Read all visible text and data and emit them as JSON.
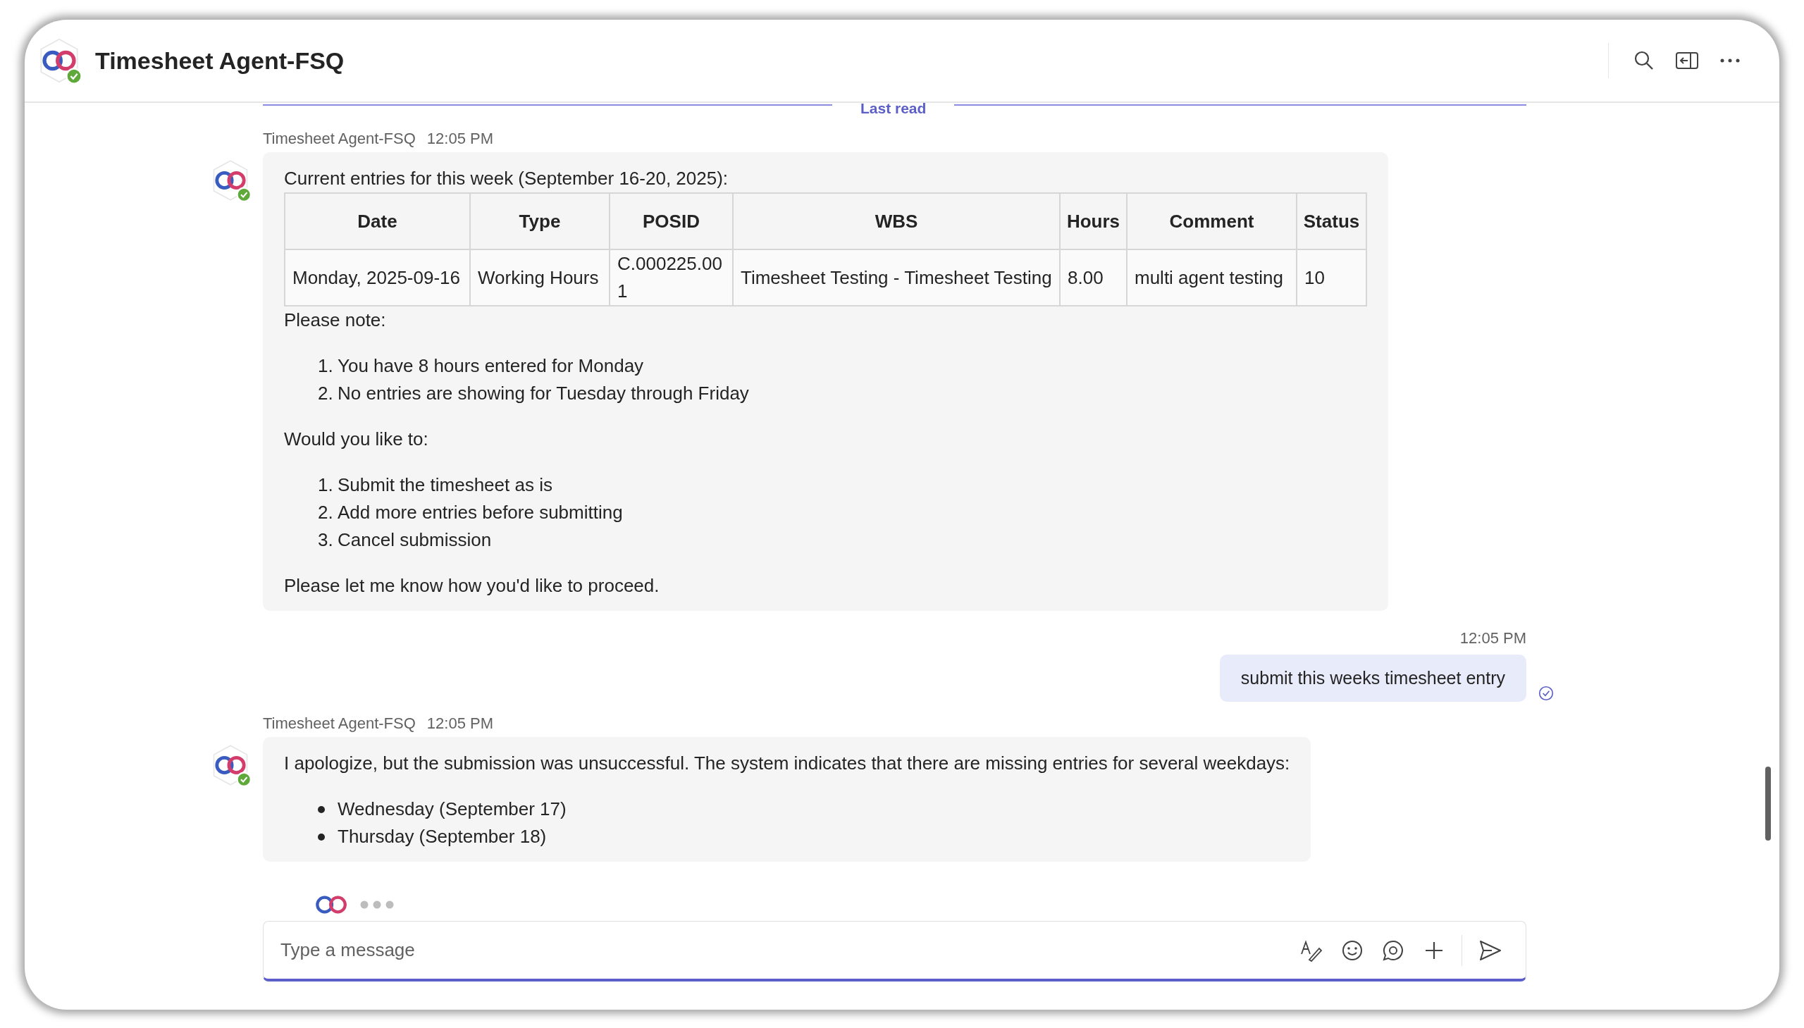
{
  "header": {
    "title": "Timesheet Agent-FSQ",
    "online": true
  },
  "last_read": "Last read",
  "messages": [
    {
      "kind": "bot",
      "sender": "Timesheet Agent-FSQ",
      "time": "12:05 PM",
      "online": true,
      "blocks": [
        {
          "kind": "paragraph",
          "text": "Current entries for this week (September 16-20, 2025):"
        },
        {
          "kind": "table",
          "columns": [
            "Date",
            "Type",
            "POSID",
            "WBS",
            "Hours",
            "Comment",
            "Status"
          ],
          "rows": [
            [
              "Monday, 2025-09-16",
              "Working Hours",
              "C.000225.001",
              "Timesheet Testing - Timesheet Testing",
              "8.00",
              "multi agent testing",
              "10"
            ]
          ]
        },
        {
          "kind": "paragraph",
          "text": "Please note:"
        },
        {
          "kind": "ordered_list",
          "items": [
            {
              "number": "1.",
              "text": "You have 8 hours entered for Monday"
            },
            {
              "number": "2.",
              "text": "No entries are showing for Tuesday through Friday"
            }
          ]
        },
        {
          "kind": "paragraph",
          "text": "Would you like to:"
        },
        {
          "kind": "ordered_list",
          "items": [
            {
              "number": "1.",
              "text": "Submit the timesheet as is"
            },
            {
              "number": "2.",
              "text": "Add more entries before submitting"
            },
            {
              "number": "3.",
              "text": "Cancel submission"
            }
          ]
        },
        {
          "kind": "paragraph",
          "text": "Please let me know how you'd like to proceed."
        }
      ]
    },
    {
      "kind": "user",
      "time": "12:05 PM",
      "text": "submit this weeks timesheet entry",
      "read": true
    },
    {
      "kind": "bot",
      "sender": "Timesheet Agent-FSQ",
      "time": "12:05 PM",
      "online": true,
      "blocks": [
        {
          "kind": "paragraph",
          "text": "I apologize, but the submission was unsuccessful. The system indicates that there are missing entries for several weekdays:"
        },
        {
          "kind": "bullet_list",
          "items": [
            "Wednesday (September 17)",
            "Thursday (September 18)"
          ]
        }
      ]
    }
  ],
  "composer": {
    "placeholder": "Type a message"
  }
}
